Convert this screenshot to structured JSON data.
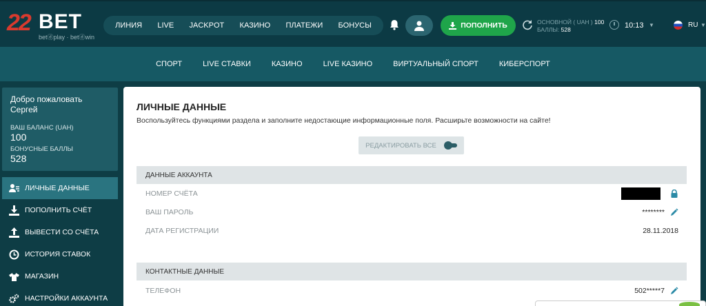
{
  "logo": {
    "number": "22",
    "brand": "BET",
    "tagline": "betⓓplay · betⓓwin"
  },
  "nav": [
    "ЛИНИЯ",
    "LIVE",
    "JACKPOT",
    "КАЗИНО",
    "ПЛАТЕЖИ",
    "БОНУСЫ"
  ],
  "header": {
    "deposit_label": "ПОПОЛНИТЬ",
    "balance_main_label": "ОСНОВНОЙ ( UAH )",
    "balance_main_value": "100",
    "balance_bonus_label": "БАЛЛЫ:",
    "balance_bonus_value": "528",
    "time": "10:13",
    "lang": "RU"
  },
  "subnav": [
    "СПОРТ",
    "LIVE СТАВКИ",
    "КАЗИНО",
    "LIVE КАЗИНО",
    "ВИРТУАЛЬНЫЙ СПОРТ",
    "КИБЕРСПОРТ"
  ],
  "sidebar": {
    "welcome": "Добро пожаловать",
    "username": "Сергей",
    "balance_label": "ВАШ БАЛАНС (UAH)",
    "balance_value": "100",
    "bonus_label": "БОНУСНЫЕ БАЛЛЫ",
    "bonus_value": "528",
    "items": [
      {
        "label": "ЛИЧНЫЕ ДАННЫЕ",
        "icon": "user-card-icon"
      },
      {
        "label": "ПОПОЛНИТЬ СЧЁТ",
        "icon": "download-icon"
      },
      {
        "label": "ВЫВЕСТИ СО СЧЁТА",
        "icon": "upload-icon"
      },
      {
        "label": "ИСТОРИЯ СТАВОК",
        "icon": "clock-icon"
      },
      {
        "label": "МАГАЗИН",
        "icon": "shirt-icon"
      },
      {
        "label": "НАСТРОЙКИ АККАУНТА",
        "icon": "gears-icon"
      }
    ]
  },
  "main": {
    "title": "ЛИЧНЫЕ ДАННЫЕ",
    "description": "Воспользуйтесь функциями раздела и заполните недостающие информационные поля. Расширьте возможности на сайте!",
    "edit_all_label": "РЕДАКТИРОВАТЬ ВСЕ",
    "account_section": "ДАННЫЕ АККАУНТА",
    "account_number_label": "НОМЕР СЧЁТА",
    "password_label": "ВАШ ПАРОЛЬ",
    "password_value": "********",
    "reg_date_label": "ДАТА РЕГИСТРАЦИИ",
    "reg_date_value": "28.11.2018",
    "contact_section": "КОНТАКТНЫЕ ДАННЫЕ",
    "phone_label": "ТЕЛЕФОН",
    "phone_value": "502*****7"
  },
  "colors": {
    "accent_green": "#1fa54a",
    "header_bg": "#0c3a44",
    "edit_icon": "#2a8aa6"
  }
}
